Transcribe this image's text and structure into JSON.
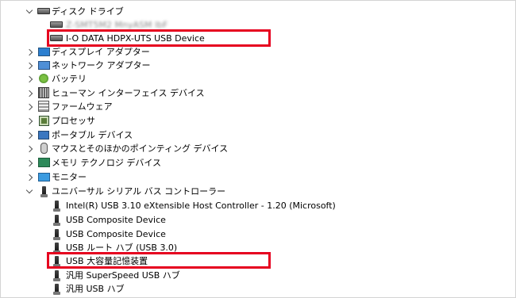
{
  "colors": {
    "highlight": "#e6001f"
  },
  "tree": {
    "disk_drives": {
      "label": "ディスク ドライブ",
      "icon": "disk-drive-icon",
      "children": [
        {
          "label": "Z-SMT5M2 MnyASM lbF",
          "icon": "disk-drive-icon",
          "blurred": true
        },
        {
          "label": "I-O DATA HDPX-UTS USB Device",
          "icon": "disk-drive-icon",
          "highlighted": true
        }
      ]
    },
    "categories": [
      {
        "label": "ディスプレイ アダプター",
        "icon": "display-adapter-icon"
      },
      {
        "label": "ネットワーク アダプター",
        "icon": "network-adapter-icon"
      },
      {
        "label": "バッテリ",
        "icon": "battery-icon"
      },
      {
        "label": "ヒューマン インターフェイス デバイス",
        "icon": "hid-icon"
      },
      {
        "label": "ファームウェア",
        "icon": "firmware-icon"
      },
      {
        "label": "プロセッサ",
        "icon": "processor-icon"
      },
      {
        "label": "ポータブル デバイス",
        "icon": "portable-device-icon"
      },
      {
        "label": "マウスとそのほかのポインティング デバイス",
        "icon": "mouse-icon"
      },
      {
        "label": "メモリ テクノロジ デバイス",
        "icon": "memory-icon"
      },
      {
        "label": "モニター",
        "icon": "monitor-icon"
      }
    ],
    "usb_controllers": {
      "label": "ユニバーサル シリアル バス コントローラー",
      "icon": "usb-icon",
      "children": [
        {
          "label": "Intel(R) USB 3.10 eXtensible Host Controller - 1.20 (Microsoft)",
          "icon": "usb-icon"
        },
        {
          "label": "USB Composite Device",
          "icon": "usb-icon"
        },
        {
          "label": "USB Composite Device",
          "icon": "usb-icon"
        },
        {
          "label": "USB ルート ハブ (USB 3.0)",
          "icon": "usb-icon"
        },
        {
          "label": "USB 大容量記憶装置",
          "icon": "usb-icon",
          "highlighted": true
        },
        {
          "label": "汎用 SuperSpeed USB ハブ",
          "icon": "usb-icon"
        },
        {
          "label": "汎用 USB ハブ",
          "icon": "usb-icon"
        }
      ]
    }
  }
}
